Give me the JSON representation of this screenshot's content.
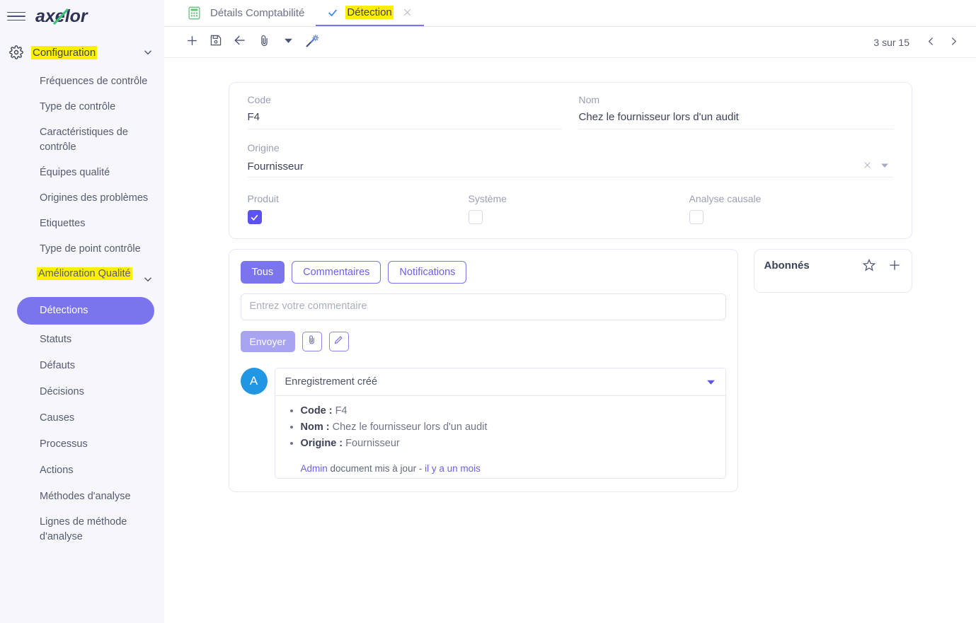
{
  "brand": {
    "name": "axelor",
    "logo_accent_color": "#3ec27e",
    "logo_text_color": "#2e3356"
  },
  "sidebar": {
    "menu_icon": "hamburger-menu-icon",
    "header": {
      "icon": "gear-icon",
      "label": "Configuration",
      "highlighted": true,
      "chevron": "chevron-down-icon"
    },
    "items": [
      {
        "label": "Fréquences de contrôle"
      },
      {
        "label": "Type de contrôle"
      },
      {
        "label": "Caractéristiques de contrôle"
      },
      {
        "label": "Équipes qualité"
      },
      {
        "label": "Origines des problèmes"
      },
      {
        "label": "Etiquettes"
      },
      {
        "label": "Type de point contrôle"
      }
    ],
    "group": {
      "label": "Amélioration Qualité",
      "highlighted": true,
      "chevron": "chevron-down-icon"
    },
    "sub_items": [
      {
        "label": "Détections",
        "active": true
      },
      {
        "label": "Statuts",
        "active": false
      },
      {
        "label": "Défauts",
        "active": false
      },
      {
        "label": "Décisions",
        "active": false
      },
      {
        "label": "Causes",
        "active": false
      },
      {
        "label": "Processus",
        "active": false
      },
      {
        "label": "Actions",
        "active": false
      },
      {
        "label": "Méthodes d'analyse",
        "active": false
      },
      {
        "label": "Lignes de méthode d'analyse",
        "active": false
      }
    ],
    "active_bg_color": "#7a74ed",
    "highlight_color": "#ffef00"
  },
  "tabs": [
    {
      "label": "Détails Comptabilité",
      "icon": "calculator-icon",
      "active": false,
      "closable": false
    },
    {
      "label": "Détection",
      "icon": "check-icon",
      "active": true,
      "closable": true,
      "highlighted": true,
      "close_icon": "close-icon"
    }
  ],
  "toolbar": {
    "buttons": [
      {
        "name": "new-record-button",
        "icon": "plus-icon"
      },
      {
        "name": "save-button",
        "icon": "save-icon"
      },
      {
        "name": "back-button",
        "icon": "arrow-left-icon"
      },
      {
        "name": "attachment-button",
        "icon": "paperclip-icon"
      },
      {
        "name": "more-actions-button",
        "icon": "caret-down-icon"
      },
      {
        "name": "magic-button",
        "icon": "magic-wand-icon"
      }
    ],
    "pagination": {
      "count_label": "3 sur 15",
      "prev_icon": "chevron-left-icon",
      "next_icon": "chevron-right-icon"
    }
  },
  "form": {
    "code": {
      "label": "Code",
      "value": "F4"
    },
    "nom": {
      "label": "Nom",
      "value": "Chez le fournisseur lors d'un audit"
    },
    "origine": {
      "label": "Origine",
      "value": "Fournisseur",
      "clear_icon": "close-icon",
      "dropdown_icon": "caret-down-icon"
    },
    "checkboxes": [
      {
        "label": "Produit",
        "checked": true
      },
      {
        "label": "Système",
        "checked": false
      },
      {
        "label": "Analyse causale",
        "checked": false
      }
    ],
    "checked_color": "#5b52f0"
  },
  "messages_panel": {
    "tabs": [
      {
        "label": "Tous",
        "active": true
      },
      {
        "label": "Commentaires",
        "active": false
      },
      {
        "label": "Notifications",
        "active": false
      }
    ],
    "comment_placeholder": "Entrez votre commentaire",
    "comment_value": "",
    "send_label": "Envoyer",
    "attach_icon": "paperclip-icon",
    "edit_icon": "pencil-icon",
    "message": {
      "avatar_initial": "A",
      "avatar_color": "#2196e3",
      "title": "Enregistrement créé",
      "expand_icon": "caret-down-icon",
      "fields": [
        {
          "label": "Code :",
          "value": "F4"
        },
        {
          "label": "Nom :",
          "value": "Chez le fournisseur lors d'un audit"
        },
        {
          "label": "Origine :",
          "value": "Fournisseur"
        }
      ],
      "footer_author": "Admin",
      "footer_text": " document mis à jour - ",
      "footer_time": "il y a un mois"
    }
  },
  "subscribers": {
    "title": "Abonnés",
    "star_icon": "star-icon",
    "add_icon": "plus-icon"
  }
}
